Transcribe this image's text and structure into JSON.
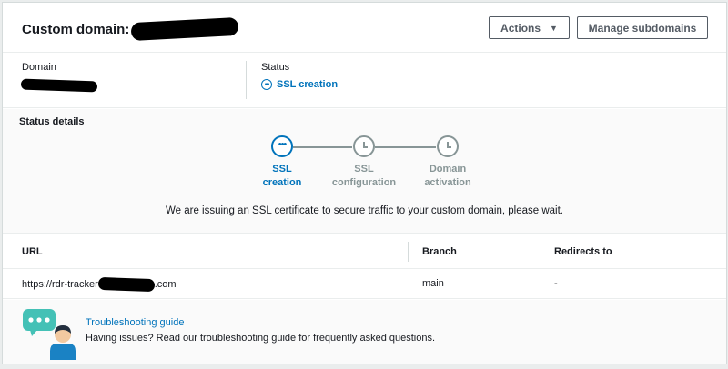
{
  "header": {
    "title": "Custom domain:",
    "actions_label": "Actions",
    "manage_label": "Manage subdomains"
  },
  "domain_section": {
    "domain_label": "Domain",
    "status_label": "Status",
    "status_value": "SSL creation",
    "status_icon": "pending-dots-icon"
  },
  "status_details": {
    "title": "Status details",
    "steps": [
      {
        "line1": "SSL",
        "line2": "creation",
        "state": "active",
        "icon": "pending-dots-icon"
      },
      {
        "line1": "SSL",
        "line2": "configuration",
        "state": "pending",
        "icon": "clock-icon"
      },
      {
        "line1": "Domain",
        "line2": "activation",
        "state": "pending",
        "icon": "clock-icon"
      }
    ],
    "message": "We are issuing an SSL certificate to secure traffic to your custom domain, please wait."
  },
  "table": {
    "columns": [
      "URL",
      "Branch",
      "Redirects to"
    ],
    "rows": [
      {
        "url_prefix": "https://rdr-tracker",
        "url_suffix": ".com",
        "branch": "main",
        "redirects": "-"
      }
    ]
  },
  "help": {
    "link": "Troubleshooting guide",
    "text": "Having issues? Read our troubleshooting guide for frequently asked questions."
  },
  "colors": {
    "link_blue": "#0073bb",
    "pending_gray": "#879596",
    "help_bubble": "#44c1b6",
    "help_person": "#1a82c4"
  }
}
